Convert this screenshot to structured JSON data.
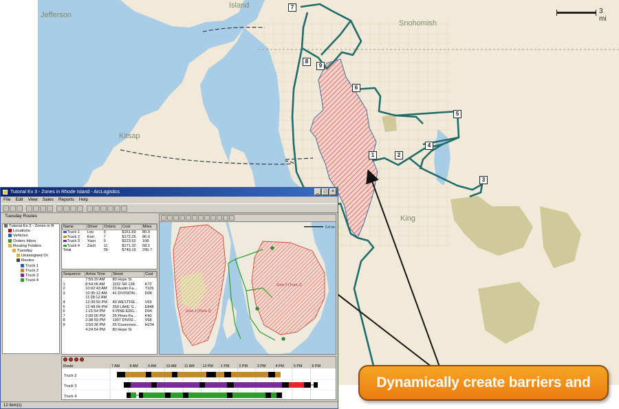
{
  "map": {
    "labels": {
      "island": "Island",
      "jefferson": "Jefferson",
      "snohomish": "Snohomish",
      "kitsap": "Kitsap",
      "king": "King"
    },
    "scale_label": "3 mi",
    "stop_markers": [
      "7",
      "8",
      "9",
      "6",
      "5",
      "4",
      "1",
      "2",
      "3"
    ],
    "colors": {
      "route": "#1f6b6b",
      "barrier": "#d8473a",
      "barrier_fill": "#f2c3bb",
      "water": "#a9cde6",
      "land": "#f1ead8",
      "park": "#c8c089"
    }
  },
  "app": {
    "title": "Tutorial Ex 3 - Zones in Rhode Island - ArcLogistics",
    "menu": [
      "File",
      "Edit",
      "View",
      "Sales",
      "Reports",
      "Help"
    ],
    "panel_title": "Tuesday Routes",
    "tree": [
      {
        "label": "Tutorial Ex 3 - Zones in R",
        "indent": 0,
        "icon": "project-icon",
        "color": "#6b6b6b"
      },
      {
        "label": "Locations",
        "indent": 1,
        "icon": "location-icon",
        "color": "#b01010"
      },
      {
        "label": "Vehicles",
        "indent": 1,
        "icon": "vehicle-icon",
        "color": "#2a5db0"
      },
      {
        "label": "Orders Inbox",
        "indent": 1,
        "icon": "inbox-icon",
        "color": "#4a8a2a"
      },
      {
        "label": "Routing Folders",
        "indent": 1,
        "icon": "folder-icon",
        "color": "#d8b040"
      },
      {
        "label": "Tuesday",
        "indent": 2,
        "icon": "folder-icon",
        "color": "#d8b040"
      },
      {
        "label": "Unassigned Or",
        "indent": 3,
        "icon": "unassigned-icon",
        "color": "#d8b040"
      },
      {
        "label": "Routes",
        "indent": 3,
        "icon": "routes-icon",
        "color": "#444444"
      },
      {
        "label": "Truck 1",
        "indent": 4,
        "icon": "route-line-icon",
        "color": "#2a5db0"
      },
      {
        "label": "Truck 2",
        "indent": 4,
        "icon": "route-line-icon",
        "color": "#c8882a"
      },
      {
        "label": "Truck 3",
        "indent": 4,
        "icon": "route-line-icon",
        "color": "#7a2a9a"
      },
      {
        "label": "Truck 4",
        "indent": 4,
        "icon": "route-line-icon",
        "color": "#2aa02a"
      }
    ],
    "route_grid": {
      "headers": [
        "Name",
        "Driver",
        "Orders",
        "Cost",
        "Miles"
      ],
      "rows": [
        {
          "name": "Truck 1",
          "driver": "Lou",
          "orders": "9",
          "cost": "$161.69",
          "miles": "80.9",
          "color": "#2a5db0"
        },
        {
          "name": "Truck 2",
          "driver": "Karl",
          "orders": "7",
          "cost": "$172.25",
          "miles": "86.0",
          "color": "#c8882a"
        },
        {
          "name": "Truck 3",
          "driver": "Yasn",
          "orders": "9",
          "cost": "$223.92",
          "miles": "108.",
          "color": "#7a2a9a"
        },
        {
          "name": "Truck 4",
          "driver": "Zach",
          "orders": "11",
          "cost": "$171.32",
          "miles": "68.2",
          "color": "#2aa02a"
        },
        {
          "name": "Total",
          "driver": "",
          "orders": "36",
          "cost": "$749.16",
          "miles": "295.7",
          "color": ""
        }
      ]
    },
    "stop_grid": {
      "headers": [
        "Sequence",
        "Arrive Time",
        "Street",
        "Cust"
      ],
      "rows": [
        {
          "seq": "",
          "time": "7:59:20 AM",
          "street": "80 Hope St",
          "cust": ""
        },
        {
          "seq": "1",
          "time": "8:54:06 AM",
          "street": "1152 SR 138",
          "cust": "K72"
        },
        {
          "seq": "2",
          "time": "10:02:43 AM",
          "street": "23 Austin Fa...",
          "cust": "T109"
        },
        {
          "seq": "3",
          "time": "10:35:12 AM",
          "street": "41 DIVISION...",
          "cust": "D08"
        },
        {
          "seq": "",
          "time": "11:28:12 AM",
          "street": "",
          "cust": ""
        },
        {
          "seq": "4",
          "time": "12:30:59 PM",
          "street": "40 WESTFIE...",
          "cust": "V69"
        },
        {
          "seq": "5",
          "time": "12:48:04 PM",
          "street": "259 LAKE S...",
          "cust": "E848"
        },
        {
          "seq": "6",
          "time": "1:21:54 PM",
          "street": "6 PINE EDG...",
          "cust": "D04"
        },
        {
          "seq": "7",
          "time": "2:00:00 PM",
          "street": "35 Pines Fa...",
          "cust": "K40"
        },
        {
          "seq": "8",
          "time": "2:38:59 PM",
          "street": "1997 DIVISI...",
          "cust": "V68"
        },
        {
          "seq": "9",
          "time": "3:50:36 PM",
          "street": "56 Governors...",
          "cust": "H234"
        },
        {
          "seq": "",
          "time": "4:24:54 PM",
          "street": "80 Hope St",
          "cust": ""
        }
      ]
    },
    "inner_map": {
      "scale_label": "0.4 mi",
      "zone_labels": [
        "Zone 1 (Truck 2)",
        "Zone 2 (Truck 3)"
      ]
    },
    "gantt": {
      "header_label": "Route",
      "times": [
        "7 AM",
        "8 AM",
        "9 AM",
        "10 AM",
        "11 AM",
        "12 PM",
        "1 PM",
        "2 PM",
        "3 PM",
        "4 PM",
        "5 PM",
        "6 PM"
      ],
      "rows": [
        {
          "label": "Truck 2",
          "color": "#c8882a"
        },
        {
          "label": "Truck 3",
          "color": "#7a2a9a"
        },
        {
          "label": "Truck 4",
          "color": "#2aa02a"
        }
      ]
    },
    "status_text": "12 item(s)"
  },
  "callout": {
    "text": "Dynamically create barriers and zones."
  }
}
